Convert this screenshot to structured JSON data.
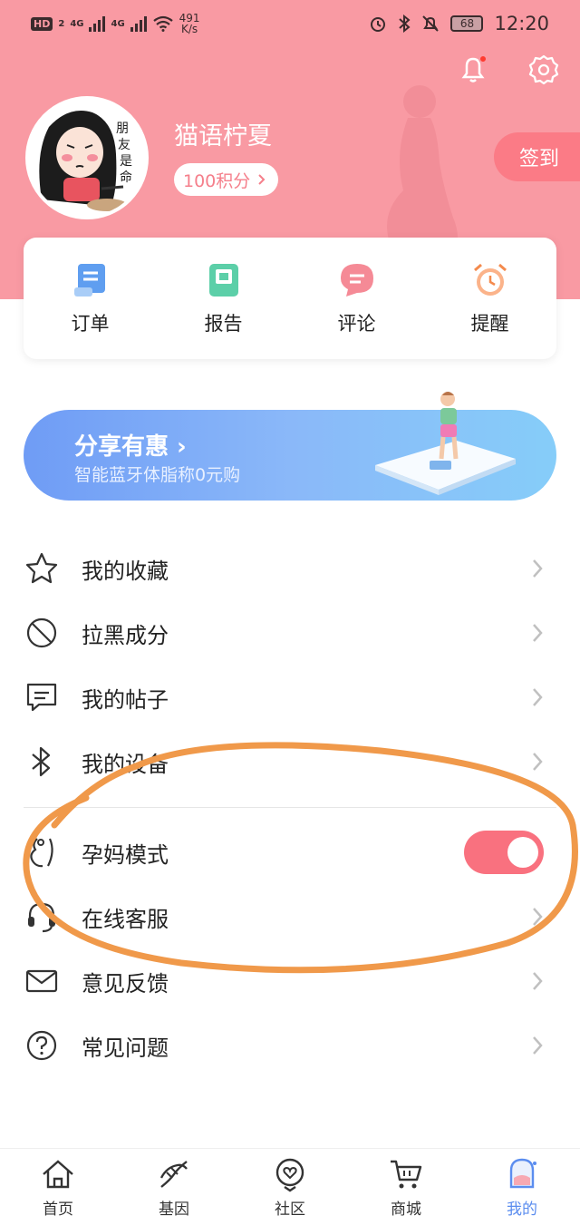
{
  "status_bar": {
    "network": "HD",
    "network_sub": "2",
    "sig1": "4G",
    "sig2": "4G",
    "speed_value": "491",
    "speed_unit": "K/s",
    "battery": "68",
    "time": "12:20"
  },
  "header": {
    "username": "猫语柠夏",
    "points": "100积分",
    "checkin": "签到",
    "bell_has_dot": true
  },
  "quick_actions": [
    {
      "label": "订单",
      "icon": "order-icon"
    },
    {
      "label": "报告",
      "icon": "report-icon"
    },
    {
      "label": "评论",
      "icon": "comment-icon"
    },
    {
      "label": "提醒",
      "icon": "alarm-clock-icon"
    }
  ],
  "banner": {
    "title": "分享有惠 ›",
    "subtitle": "智能蓝牙体脂称0元购"
  },
  "menu": [
    {
      "label": "我的收藏",
      "icon": "star-icon",
      "type": "link"
    },
    {
      "label": "拉黑成分",
      "icon": "block-icon",
      "type": "link"
    },
    {
      "label": "我的帖子",
      "icon": "post-icon",
      "type": "link"
    },
    {
      "label": "我的设备",
      "icon": "bluetooth-icon",
      "type": "link"
    },
    {
      "label": "孕妈模式",
      "icon": "pregnant-icon",
      "type": "toggle",
      "on": true
    },
    {
      "label": "在线客服",
      "icon": "headset-icon",
      "type": "link"
    },
    {
      "label": "意见反馈",
      "icon": "mail-icon",
      "type": "link"
    },
    {
      "label": "常见问题",
      "icon": "question-icon",
      "type": "link"
    }
  ],
  "tabs": [
    {
      "label": "首页",
      "icon": "home-icon",
      "active": false
    },
    {
      "label": "基因",
      "icon": "dna-icon",
      "active": false
    },
    {
      "label": "社区",
      "icon": "community-icon",
      "active": false
    },
    {
      "label": "商城",
      "icon": "cart-icon",
      "active": false
    },
    {
      "label": "我的",
      "icon": "profile-icon",
      "active": true
    }
  ],
  "colors": {
    "header_bg": "#f99aa3",
    "accent_pink": "#f9717f",
    "active_tab": "#5b8def",
    "annotation_orange": "#f0994a"
  }
}
